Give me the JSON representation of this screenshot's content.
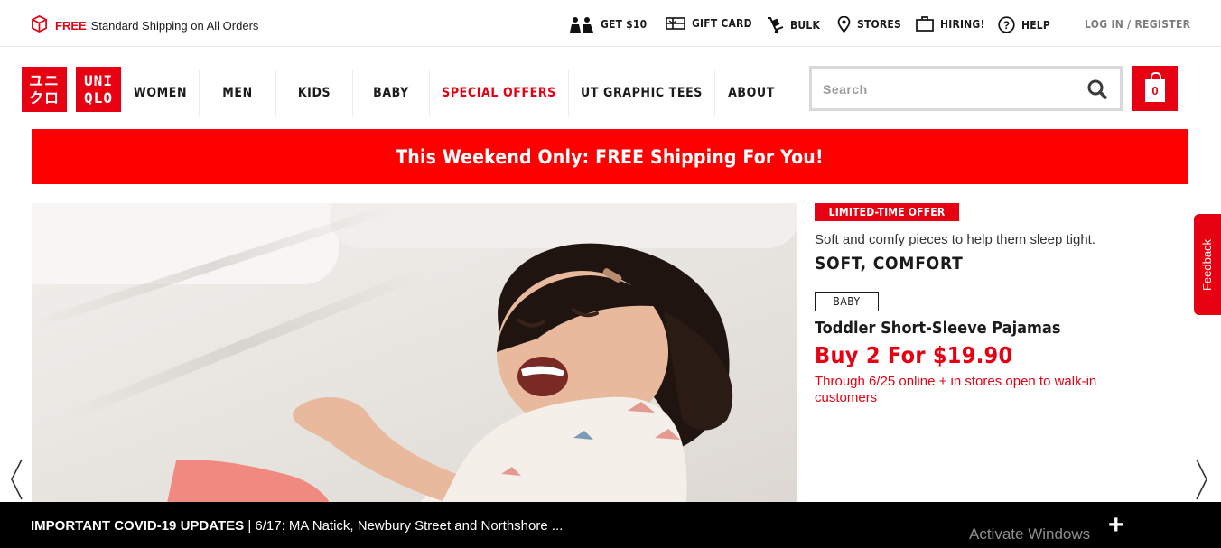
{
  "topbar": {
    "promo_free": "FREE",
    "promo_text": "Standard Shipping on All Orders",
    "links": [
      {
        "label": "GET $10",
        "icon": "referral-people-icon"
      },
      {
        "label": "GIFT CARD",
        "icon": "gift-card-icon"
      },
      {
        "label": "BULK",
        "icon": "hand-truck-icon"
      },
      {
        "label": "STORES",
        "icon": "map-pin-icon"
      },
      {
        "label": "HIRING!",
        "icon": "briefcase-icon"
      },
      {
        "label": "HELP",
        "icon": "question-circle-icon"
      }
    ],
    "login": "LOG IN / REGISTER"
  },
  "logo": {
    "left_top": "ユニ",
    "left_bottom": "クロ",
    "right_top": "UNI",
    "right_bottom": "QLO"
  },
  "nav": [
    "WOMEN",
    "MEN",
    "KIDS",
    "BABY",
    "SPECIAL OFFERS",
    "UT GRAPHIC TEES",
    "ABOUT"
  ],
  "search": {
    "placeholder": "Search"
  },
  "cart": {
    "count": "0"
  },
  "banner": "This Weekend Only: FREE Shipping For You!",
  "promo": {
    "tag": "LIMITED-TIME OFFER",
    "subtext": "Soft and comfy pieces to help them sleep tight.",
    "headline": "SOFT, COMFORT",
    "category": "BABY",
    "product": "Toddler Short-Sleeve Pajamas",
    "price": "Buy 2 For $19.90",
    "availability": "Through 6/25 online + in stores open to walk-in customers"
  },
  "feedback": "Feedback",
  "covid": {
    "bold": "IMPORTANT COVID-19 UPDATES",
    "text": "| 6/17: MA Natick, Newbury Street and Northshore ..."
  },
  "overlay": {
    "activate": "Activate Windows"
  },
  "colors": {
    "brand_red": "#e60012",
    "banner_red": "#ff0000"
  }
}
